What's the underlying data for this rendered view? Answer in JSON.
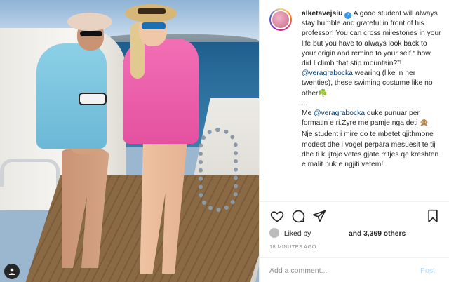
{
  "post": {
    "username": "alketavejsiu",
    "caption": {
      "line1": "A good student will always stay humble and grateful in front of his professor! You can cross milestones in your life but you have to always look back to your origin and remind to your self “ how did I climb that stip mountain?”!",
      "mention1": "@veragrabocka",
      "line2": " wearing (like in her twenties), these swiming costume like no other",
      "clover": "☘️",
      "ellipsis": "...",
      "me": "Me ",
      "mention2": "@veragrabocka",
      "line3": " duke punuar per formatin e ri.Zyre me pamje nga deti ",
      "emoji_face": "🙊",
      "line4": "Nje student i mire do te mbetet gjithmone modest dhe i vogel perpara mesuesit te tij dhe ti kujtoje vetes gjate rritjes qe kreshten e malit nuk e ngjiti vetem!"
    },
    "likes": {
      "liked_by": "Liked by",
      "and_others": "and 3,369 others"
    },
    "time_ago": "18 MINUTES AGO",
    "comment": {
      "placeholder": "Add a comment...",
      "post_label": "Post"
    }
  },
  "icons": {
    "verified": "✓",
    "like": "heart-icon",
    "comment": "comment-icon",
    "share": "paper-plane-icon",
    "save": "bookmark-icon",
    "tagged": "person-tag-icon"
  }
}
